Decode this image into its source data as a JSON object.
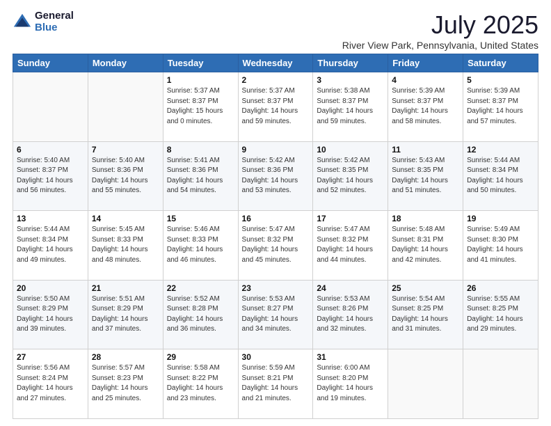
{
  "logo": {
    "general": "General",
    "blue": "Blue"
  },
  "title": "July 2025",
  "subtitle": "River View Park, Pennsylvania, United States",
  "days_of_week": [
    "Sunday",
    "Monday",
    "Tuesday",
    "Wednesday",
    "Thursday",
    "Friday",
    "Saturday"
  ],
  "weeks": [
    [
      {
        "day": "",
        "detail": ""
      },
      {
        "day": "",
        "detail": ""
      },
      {
        "day": "1",
        "detail": "Sunrise: 5:37 AM\nSunset: 8:37 PM\nDaylight: 15 hours\nand 0 minutes."
      },
      {
        "day": "2",
        "detail": "Sunrise: 5:37 AM\nSunset: 8:37 PM\nDaylight: 14 hours\nand 59 minutes."
      },
      {
        "day": "3",
        "detail": "Sunrise: 5:38 AM\nSunset: 8:37 PM\nDaylight: 14 hours\nand 59 minutes."
      },
      {
        "day": "4",
        "detail": "Sunrise: 5:39 AM\nSunset: 8:37 PM\nDaylight: 14 hours\nand 58 minutes."
      },
      {
        "day": "5",
        "detail": "Sunrise: 5:39 AM\nSunset: 8:37 PM\nDaylight: 14 hours\nand 57 minutes."
      }
    ],
    [
      {
        "day": "6",
        "detail": "Sunrise: 5:40 AM\nSunset: 8:37 PM\nDaylight: 14 hours\nand 56 minutes."
      },
      {
        "day": "7",
        "detail": "Sunrise: 5:40 AM\nSunset: 8:36 PM\nDaylight: 14 hours\nand 55 minutes."
      },
      {
        "day": "8",
        "detail": "Sunrise: 5:41 AM\nSunset: 8:36 PM\nDaylight: 14 hours\nand 54 minutes."
      },
      {
        "day": "9",
        "detail": "Sunrise: 5:42 AM\nSunset: 8:36 PM\nDaylight: 14 hours\nand 53 minutes."
      },
      {
        "day": "10",
        "detail": "Sunrise: 5:42 AM\nSunset: 8:35 PM\nDaylight: 14 hours\nand 52 minutes."
      },
      {
        "day": "11",
        "detail": "Sunrise: 5:43 AM\nSunset: 8:35 PM\nDaylight: 14 hours\nand 51 minutes."
      },
      {
        "day": "12",
        "detail": "Sunrise: 5:44 AM\nSunset: 8:34 PM\nDaylight: 14 hours\nand 50 minutes."
      }
    ],
    [
      {
        "day": "13",
        "detail": "Sunrise: 5:44 AM\nSunset: 8:34 PM\nDaylight: 14 hours\nand 49 minutes."
      },
      {
        "day": "14",
        "detail": "Sunrise: 5:45 AM\nSunset: 8:33 PM\nDaylight: 14 hours\nand 48 minutes."
      },
      {
        "day": "15",
        "detail": "Sunrise: 5:46 AM\nSunset: 8:33 PM\nDaylight: 14 hours\nand 46 minutes."
      },
      {
        "day": "16",
        "detail": "Sunrise: 5:47 AM\nSunset: 8:32 PM\nDaylight: 14 hours\nand 45 minutes."
      },
      {
        "day": "17",
        "detail": "Sunrise: 5:47 AM\nSunset: 8:32 PM\nDaylight: 14 hours\nand 44 minutes."
      },
      {
        "day": "18",
        "detail": "Sunrise: 5:48 AM\nSunset: 8:31 PM\nDaylight: 14 hours\nand 42 minutes."
      },
      {
        "day": "19",
        "detail": "Sunrise: 5:49 AM\nSunset: 8:30 PM\nDaylight: 14 hours\nand 41 minutes."
      }
    ],
    [
      {
        "day": "20",
        "detail": "Sunrise: 5:50 AM\nSunset: 8:29 PM\nDaylight: 14 hours\nand 39 minutes."
      },
      {
        "day": "21",
        "detail": "Sunrise: 5:51 AM\nSunset: 8:29 PM\nDaylight: 14 hours\nand 37 minutes."
      },
      {
        "day": "22",
        "detail": "Sunrise: 5:52 AM\nSunset: 8:28 PM\nDaylight: 14 hours\nand 36 minutes."
      },
      {
        "day": "23",
        "detail": "Sunrise: 5:53 AM\nSunset: 8:27 PM\nDaylight: 14 hours\nand 34 minutes."
      },
      {
        "day": "24",
        "detail": "Sunrise: 5:53 AM\nSunset: 8:26 PM\nDaylight: 14 hours\nand 32 minutes."
      },
      {
        "day": "25",
        "detail": "Sunrise: 5:54 AM\nSunset: 8:25 PM\nDaylight: 14 hours\nand 31 minutes."
      },
      {
        "day": "26",
        "detail": "Sunrise: 5:55 AM\nSunset: 8:25 PM\nDaylight: 14 hours\nand 29 minutes."
      }
    ],
    [
      {
        "day": "27",
        "detail": "Sunrise: 5:56 AM\nSunset: 8:24 PM\nDaylight: 14 hours\nand 27 minutes."
      },
      {
        "day": "28",
        "detail": "Sunrise: 5:57 AM\nSunset: 8:23 PM\nDaylight: 14 hours\nand 25 minutes."
      },
      {
        "day": "29",
        "detail": "Sunrise: 5:58 AM\nSunset: 8:22 PM\nDaylight: 14 hours\nand 23 minutes."
      },
      {
        "day": "30",
        "detail": "Sunrise: 5:59 AM\nSunset: 8:21 PM\nDaylight: 14 hours\nand 21 minutes."
      },
      {
        "day": "31",
        "detail": "Sunrise: 6:00 AM\nSunset: 8:20 PM\nDaylight: 14 hours\nand 19 minutes."
      },
      {
        "day": "",
        "detail": ""
      },
      {
        "day": "",
        "detail": ""
      }
    ]
  ]
}
